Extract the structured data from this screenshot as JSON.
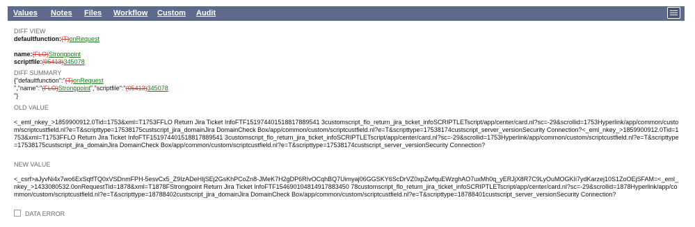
{
  "tabs": [
    {
      "label": "Values"
    },
    {
      "label": "Notes"
    },
    {
      "label": "Files"
    },
    {
      "label": "Workflow"
    },
    {
      "label": "Custom"
    },
    {
      "label": "Audit"
    }
  ],
  "diff_view": {
    "heading": "DIFF VIEW",
    "defaultfunction_label": "defaultfunction:",
    "defaultfunction_old": "(T)",
    "defaultfunction_new": "onRequest",
    "name_label": "name:",
    "name_old": "(FLO)",
    "name_new": "Strongpoint",
    "scriptfile_label": "scriptfile:",
    "scriptfile_old": "(05413)",
    "scriptfile_new": "345078"
  },
  "diff_summary": {
    "heading": "DIFF SUMMARY",
    "line1_prefix": "{\"defaultfunction\":\"",
    "line1_old": "(T)",
    "line1_new": "onRequest",
    "line2_prefix": "\",\"name\":\"",
    "line2_name_old": "(FLO)",
    "line2_name_new": "Strongpoint",
    "line2_mid": "\",\"scriptfile\":\"",
    "line2_file_old": "(05413)",
    "line2_file_new": "345078",
    "line3": "\"}"
  },
  "old_value": {
    "heading": "OLD VALUE",
    "text": "<_eml_nkey_>1859900912.0Tid=1753&xml=T1753FFLO Return Jira Ticket InfoFTF151974401518817889541 3customscript_flo_return_jira_ticket_infoSCRIPTLETscript/app/center/card.nl?sc=-29&scrollid=1753Hyperlink/app/common/custom/scriptcustfield.nl?e=T&scripttype=17538175custscript_jira_domainJira DomainCheck Box/app/common/custom/scriptcustfield.nl?e=T&scripttype=17538174custscript_server_versionSecurity Connection?<_eml_nkey_>1859900912.0Tid=1753&xml=T1753FFLO Return Jira Ticket InfoFTF151974401518817889541 3customscript_flo_return_jira_ticket_infoSCRIPTLETscript/app/center/card.nl?sc=-29&scrollid=1753Hyperlink/app/common/custom/scriptcustfield.nl?e=T&scripttype=17538175custscript_jira_domainJira DomainCheck Box/app/common/custom/scriptcustfield.nl?e=T&scripttype=17538174custscript_server_versionSecurity Connection?"
  },
  "new_value": {
    "heading": "NEW VALUE",
    "text": "<_csrf>aJyvNi4x7wo6ExSqtfTQ0xVSDnmFPH-5esvCx5_Z9IzADeHIjSEj2GsKhPCoZn8-JMeK7H2gDP6RIvOCqhBQ7Uimyaj06GGSKY6ScDrVZ0xpZwfquEWzghAO7uxMh0q_yERJjX8R7C9LyOuMOGKIi7ydKarzej10S1ZoOEjSFAM=<_eml_nkey_>1433080532.0onRequestTid=1878&xml=T1878FStrongpoint Return Jira Ticket InfoFTF154690104814917883450 78customscript_flo_return_jira_ticket_infoSCRIPTLETscript/app/center/card.nl?sc=-29&scrollid=1878Hyperlink/app/common/custom/scriptcustfield.nl?e=T&scripttype=18788402custscript_jira_domainJira DomainCheck Box/app/common/custom/scriptcustfield.nl?e=T&scripttype=18788401custscript_server_versionSecurity Connection?"
  },
  "data_error": {
    "label": "DATA ERROR"
  }
}
